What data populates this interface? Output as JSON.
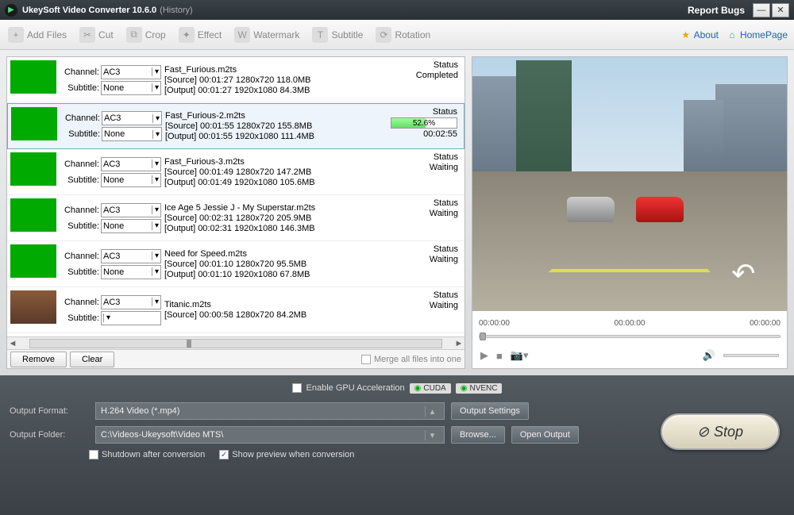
{
  "titlebar": {
    "app": "UkeySoft Video Converter 10.6.0",
    "suffix": "(History)",
    "report": "Report Bugs"
  },
  "toolbar": {
    "items": [
      "Add Files",
      "Cut",
      "Crop",
      "Effect",
      "Watermark",
      "Subtitle",
      "Rotation"
    ],
    "about": "About",
    "homepage": "HomePage"
  },
  "labels": {
    "channel": "Channel:",
    "subtitle": "Subtitle:",
    "status": "Status",
    "remove": "Remove",
    "clear": "Clear",
    "merge": "Merge all files into one",
    "gpu": "Enable GPU Acceleration",
    "cuda": "CUDA",
    "nvenc": "NVENC",
    "output_format": "Output Format:",
    "output_folder": "Output Folder:",
    "output_settings": "Output Settings",
    "browse": "Browse...",
    "open_output": "Open Output",
    "shutdown": "Shutdown after conversion",
    "show_preview": "Show preview when conversion",
    "stop": "Stop"
  },
  "output": {
    "format": "H.264 Video (*.mp4)",
    "folder": "C:\\Videos-Ukeysoft\\Video MTS\\"
  },
  "preview": {
    "t1": "00:00:00",
    "t2": "00:00:00",
    "t3": "00:00:00"
  },
  "files": [
    {
      "name": "Fast_Furious.m2ts",
      "channel": "AC3",
      "subtitle": "None",
      "source": "[Source]  00:01:27  1280x720  118.0MB",
      "output": "[Output]  00:01:27  1920x1080  84.3MB",
      "status": "Completed",
      "progress": null,
      "eta": ""
    },
    {
      "name": "Fast_Furious-2.m2ts",
      "channel": "AC3",
      "subtitle": "None",
      "source": "[Source]  00:01:55  1280x720  155.8MB",
      "output": "[Output]  00:01:55  1920x1080  111.4MB",
      "status": "",
      "progress": 52.6,
      "eta": "00:02:55",
      "selected": true
    },
    {
      "name": "Fast_Furious-3.m2ts",
      "channel": "AC3",
      "subtitle": "None",
      "source": "[Source]  00:01:49  1280x720  147.2MB",
      "output": "[Output]  00:01:49  1920x1080  105.6MB",
      "status": "Waiting",
      "progress": null,
      "eta": ""
    },
    {
      "name": "Ice Age 5  Jessie J - My Superstar.m2ts",
      "channel": "AC3",
      "subtitle": "None",
      "source": "[Source]  00:02:31  1280x720  205.9MB",
      "output": "[Output]  00:02:31  1920x1080  146.3MB",
      "status": "Waiting",
      "progress": null,
      "eta": ""
    },
    {
      "name": "Need for Speed.m2ts",
      "channel": "AC3",
      "subtitle": "None",
      "source": "[Source]  00:01:10  1280x720  95.5MB",
      "output": "[Output]  00:01:10  1920x1080  67.8MB",
      "status": "Waiting",
      "progress": null,
      "eta": ""
    },
    {
      "name": "Titanic.m2ts",
      "channel": "AC3",
      "subtitle": "",
      "source": "[Source]  00:00:58  1280x720  84.2MB",
      "output": "",
      "status": "Waiting",
      "progress": null,
      "eta": "",
      "thumb": "mov"
    }
  ]
}
